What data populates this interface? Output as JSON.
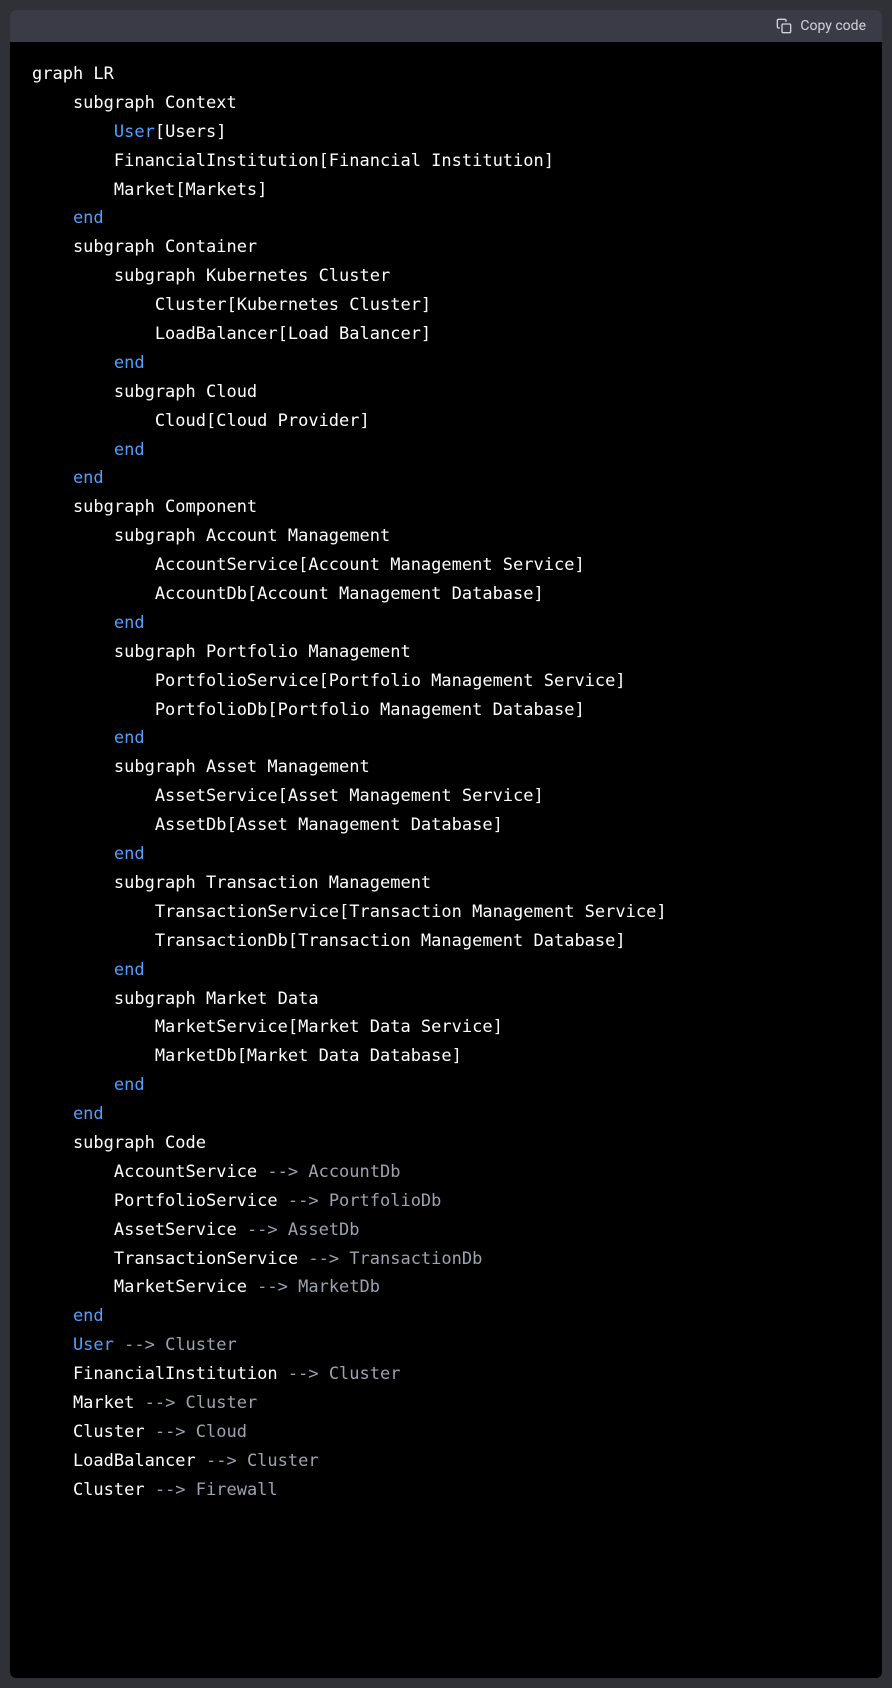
{
  "header": {
    "copy_label": "Copy code"
  },
  "code": {
    "l0": "graph LR",
    "l1a": "    subgraph Context",
    "l2_kw": "        User",
    "l2_rest": "[Users]",
    "l3": "        FinancialInstitution[Financial Institution]",
    "l4": "        Market[Markets]",
    "l5_end": "    end",
    "l6": "    subgraph Container",
    "l7": "        subgraph Kubernetes Cluster",
    "l8": "            Cluster[Kubernetes Cluster]",
    "l9": "            LoadBalancer[Load Balancer]",
    "l10_end": "        end",
    "l11": "        subgraph Cloud",
    "l12": "            Cloud[Cloud Provider]",
    "l13_end": "        end",
    "l14_end": "    end",
    "l15": "    subgraph Component",
    "l16": "        subgraph Account Management",
    "l17": "            AccountService[Account Management Service]",
    "l18": "            AccountDb[Account Management Database]",
    "l19_end": "        end",
    "l20": "        subgraph Portfolio Management",
    "l21": "            PortfolioService[Portfolio Management Service]",
    "l22": "            PortfolioDb[Portfolio Management Database]",
    "l23_end": "        end",
    "l24": "        subgraph Asset Management",
    "l25": "            AssetService[Asset Management Service]",
    "l26": "            AssetDb[Asset Management Database]",
    "l27_end": "        end",
    "l28": "        subgraph Transaction Management",
    "l29": "            TransactionService[Transaction Management Service]",
    "l30": "            TransactionDb[Transaction Management Database]",
    "l31_end": "        end",
    "l32": "        subgraph Market Data",
    "l33": "            MarketService[Market Data Service]",
    "l34": "            MarketDb[Market Data Database]",
    "l35_end": "        end",
    "l36_end": "    end",
    "l37": "    subgraph Code",
    "l38a": "        AccountService ",
    "l38b": "--> AccountDb",
    "l39a": "        PortfolioService ",
    "l39b": "--> PortfolioDb",
    "l40a": "        AssetService ",
    "l40b": "--> AssetDb",
    "l41a": "        TransactionService ",
    "l41b": "--> TransactionDb",
    "l42a": "        MarketService ",
    "l42b": "--> MarketDb",
    "l43_end": "    end",
    "l44a_kw": "    User",
    "l44b": " ",
    "l44c": "--> Cluster",
    "l45a": "    FinancialInstitution ",
    "l45b": "--> Cluster",
    "l46a": "    Market ",
    "l46b": "--> Cluster",
    "l47a": "    Cluster ",
    "l47b": "--> Cloud",
    "l48a": "    LoadBalancer ",
    "l48b": "--> Cluster",
    "l49a": "    Cluster ",
    "l49b": "--> Firewall"
  }
}
